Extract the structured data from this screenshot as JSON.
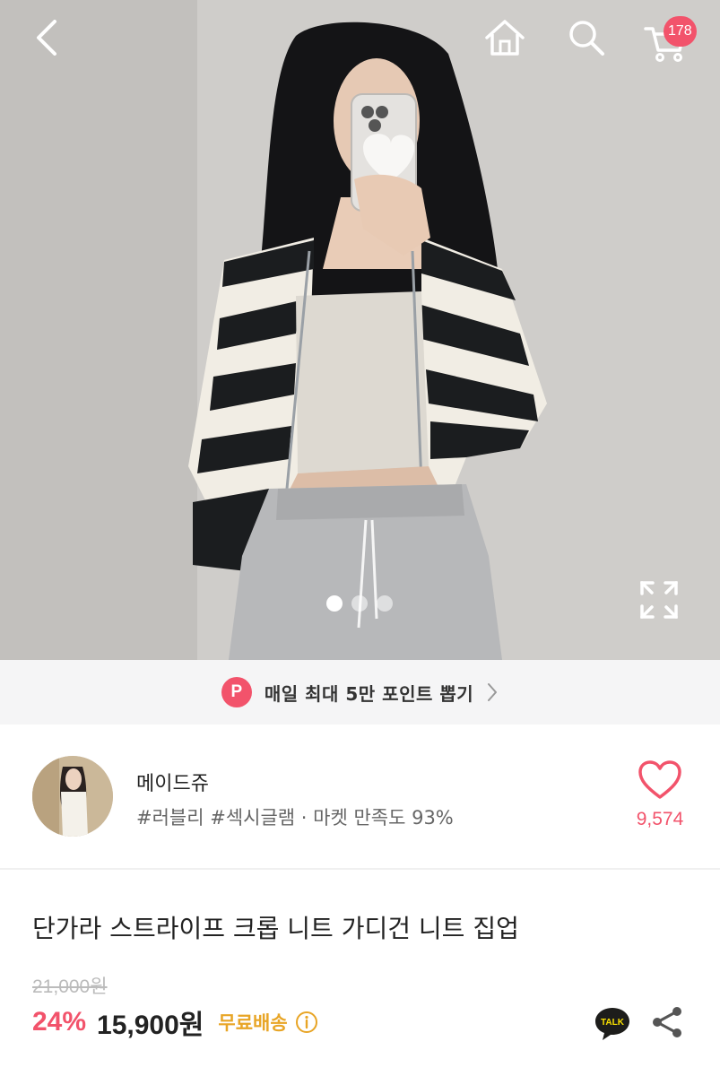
{
  "header": {
    "cart_count": "178"
  },
  "gallery": {
    "total_images": 3,
    "active_index": 1
  },
  "banner": {
    "badge": "P",
    "text": "매일 최대 5만 포인트 뽑기"
  },
  "seller": {
    "name": "메이드쥬",
    "tags": "#러블리 #섹시글램 · 마켓 만족도 93%",
    "like_count": "9,574"
  },
  "product": {
    "title": "단가라 스트라이프 크롭 니트 가디건 니트 집업",
    "original_price": "21,000원",
    "discount": "24%",
    "price": "15,900원",
    "shipping": "무료배송"
  },
  "actions": {
    "talk_label": "TALK"
  },
  "colors": {
    "accent": "#f2536b",
    "shipping": "#e8a526",
    "banner_bg": "#f5f5f6"
  }
}
